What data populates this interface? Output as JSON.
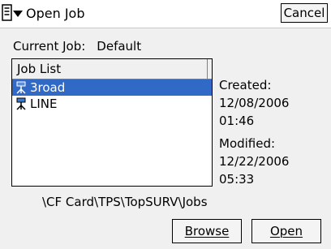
{
  "window": {
    "title": "Open Job",
    "cancel_label": "Cancel"
  },
  "current_job": {
    "label": "Current Job:",
    "value": "Default"
  },
  "job_list": {
    "header": "Job List",
    "items": [
      {
        "name": "3road",
        "selected": true,
        "icon": "job-icon"
      },
      {
        "name": "LINE",
        "selected": false,
        "icon": "job-icon"
      }
    ]
  },
  "details": {
    "created_label": "Created:",
    "created_date": "12/08/2006",
    "created_time": "01:46",
    "modified_label": "Modified:",
    "modified_date": "12/22/2006",
    "modified_time": "05:33"
  },
  "path": "\\CF Card\\TPS\\TopSURV\\Jobs",
  "buttons": {
    "browse": "Browse",
    "open": "Open"
  },
  "colors": {
    "selection": "#3169c6"
  }
}
